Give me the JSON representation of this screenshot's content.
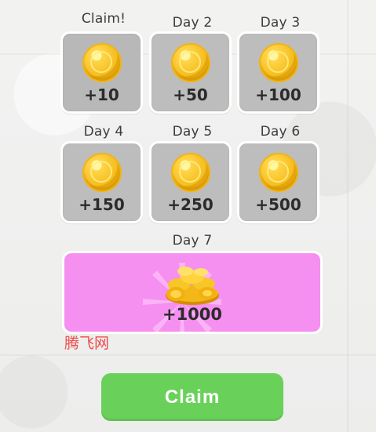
{
  "rewards": [
    {
      "label": "Claim!",
      "amount": "+10",
      "state": "claimable"
    },
    {
      "label": "Day 2",
      "amount": "+50",
      "state": "locked"
    },
    {
      "label": "Day 3",
      "amount": "+100",
      "state": "locked"
    },
    {
      "label": "Day 4",
      "amount": "+150",
      "state": "locked"
    },
    {
      "label": "Day 5",
      "amount": "+250",
      "state": "locked"
    },
    {
      "label": "Day 6",
      "amount": "+500",
      "state": "locked"
    }
  ],
  "day7": {
    "label": "Day 7",
    "amount": "+1000",
    "icon": "coin-pile-icon",
    "background": "#f58ff0"
  },
  "claim_button": {
    "label": "Claim",
    "color": "#69d159"
  },
  "watermark": "腾飞网",
  "colors": {
    "card_gray": "#bdbdbd",
    "coin_gold": "#f5bd1f"
  }
}
